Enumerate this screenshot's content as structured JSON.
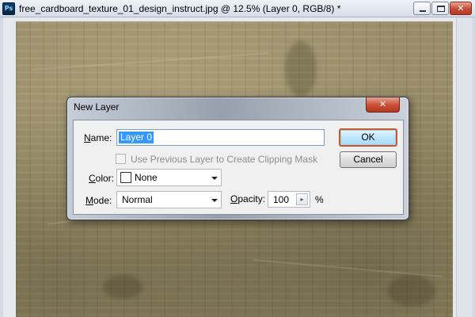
{
  "window": {
    "app_icon_text": "Ps",
    "title": "free_cardboard_texture_01_design_instruct.jpg @ 12.5% (Layer 0, RGB/8) *",
    "close_glyph": "✕"
  },
  "dialog": {
    "title": "New Layer",
    "close_glyph": "✕",
    "name_label": "Name:",
    "name_value": "Layer 0",
    "clipping_mask_label": "Use Previous Layer to Create Clipping Mask",
    "color_label": "Color:",
    "color_value": "None",
    "mode_label": "Mode:",
    "mode_value": "Normal",
    "opacity_label": "Opacity:",
    "opacity_value": "100",
    "opacity_unit": "%",
    "ok_label": "OK",
    "cancel_label": "Cancel"
  },
  "icons": {
    "app": "photoshop-icon",
    "minimize": "minimize-icon",
    "maximize": "maximize-icon",
    "close": "close-icon",
    "dropdown": "chevron-down-icon",
    "stepper": "chevron-right-icon"
  },
  "colors": {
    "ok_focus_border": "#c9582e",
    "selection": "#3399ff",
    "close_button": "#c94d35",
    "cardboard": "#9b8f68"
  }
}
